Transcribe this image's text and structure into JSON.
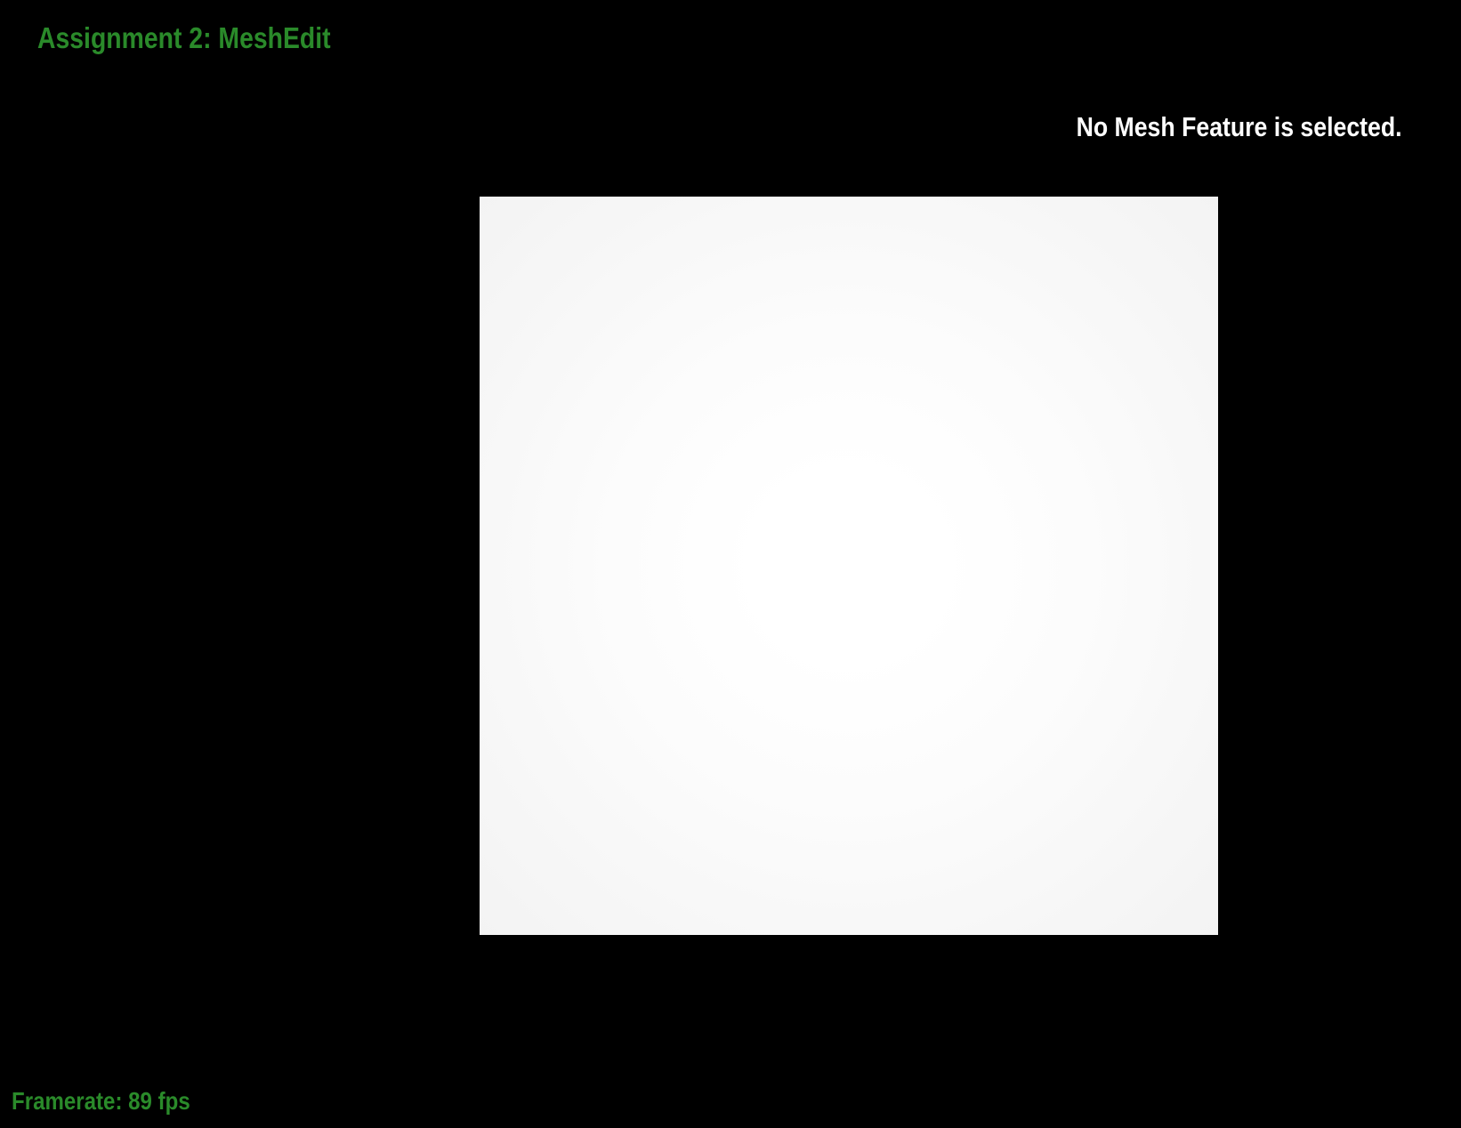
{
  "app": {
    "title": "Assignment 2: MeshEdit"
  },
  "status": {
    "selection_text": "No Mesh Feature is selected."
  },
  "footer": {
    "framerate_text": "Framerate: 89 fps"
  },
  "colors": {
    "background": "#000000",
    "accent_green": "#2a8a2a",
    "status_text": "#ffffff",
    "mesh_face": "#fafafa"
  }
}
